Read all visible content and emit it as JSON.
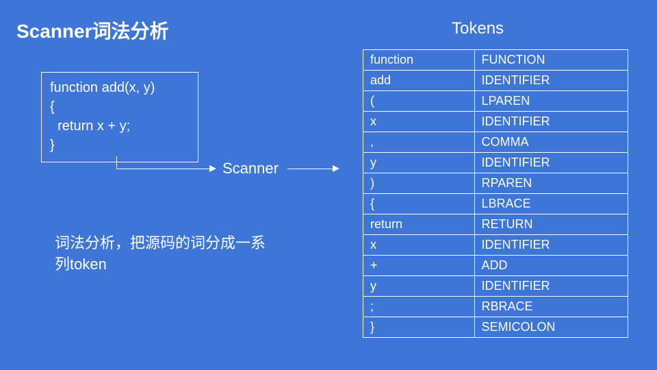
{
  "title": "Scanner词法分析",
  "tokens_heading": "Tokens",
  "code": "function add(x, y)\n{\n  return x + y;\n}",
  "scanner_label": "Scanner",
  "description": "词法分析，把源码的词分成一系列token",
  "tokens": [
    {
      "lexeme": "function",
      "type": "FUNCTION"
    },
    {
      "lexeme": "add",
      "type": "IDENTIFIER"
    },
    {
      "lexeme": "(",
      "type": "LPAREN"
    },
    {
      "lexeme": "x",
      "type": "IDENTIFIER"
    },
    {
      "lexeme": ",",
      "type": "COMMA"
    },
    {
      "lexeme": "y",
      "type": "IDENTIFIER"
    },
    {
      "lexeme": ")",
      "type": "RPAREN"
    },
    {
      "lexeme": "{",
      "type": "LBRACE"
    },
    {
      "lexeme": "return",
      "type": "RETURN"
    },
    {
      "lexeme": "x",
      "type": "IDENTIFIER"
    },
    {
      "lexeme": "+",
      "type": "ADD"
    },
    {
      "lexeme": "y",
      "type": "IDENTIFIER"
    },
    {
      "lexeme": ";",
      "type": "RBRACE"
    },
    {
      "lexeme": "}",
      "type": "SEMICOLON"
    }
  ]
}
